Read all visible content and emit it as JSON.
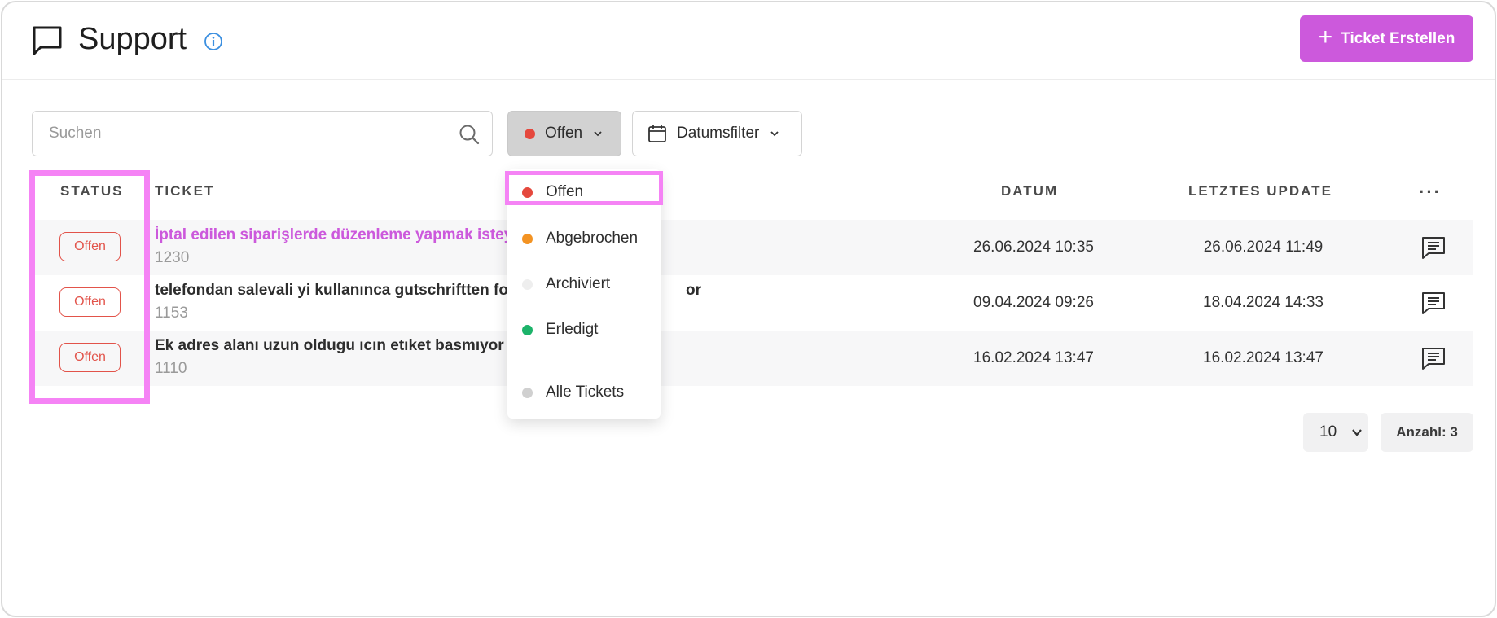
{
  "header": {
    "title": "Support",
    "create_button_label": "Ticket Erstellen"
  },
  "toolbar": {
    "search_placeholder": "Suchen",
    "status_filter_label": "Offen",
    "date_filter_label": "Datumsfilter"
  },
  "table": {
    "columns": {
      "status": "STATUS",
      "ticket": "TICKET",
      "date": "DATUM",
      "last_update": "LETZTES UPDATE",
      "more": "···"
    },
    "rows": [
      {
        "status": "Offen",
        "title": "İptal edilen siparişlerde düzenleme yapmak istey",
        "id": "1230",
        "date": "26.06.2024 10:35",
        "last_update": "26.06.2024 11:49"
      },
      {
        "status": "Offen",
        "title": "telefondan salevali yi kullanınca gutschriftten fo",
        "title_tail": "or",
        "id": "1153",
        "date": "09.04.2024 09:26",
        "last_update": "18.04.2024 14:33"
      },
      {
        "status": "Offen",
        "title": "Ek adres alanı uzun oldugu ıcın etıket basmıyor",
        "id": "1110",
        "date": "16.02.2024 13:47",
        "last_update": "16.02.2024 13:47"
      }
    ]
  },
  "status_dropdown": {
    "options": [
      {
        "label": "Offen",
        "color": "#e5483d"
      },
      {
        "label": "Abgebrochen",
        "color": "#f39323"
      },
      {
        "label": "Archiviert",
        "color": "#eeeeee"
      },
      {
        "label": "Erledigt",
        "color": "#1db36a"
      },
      {
        "label": "Alle Tickets",
        "color": "#d0d0d0"
      }
    ]
  },
  "pagination": {
    "page_size": "10",
    "count_label": "Anzahl: 3"
  },
  "colors": {
    "accent": "#cc59dc",
    "status_open": "#e2534a",
    "highlight": "#f583f5"
  }
}
